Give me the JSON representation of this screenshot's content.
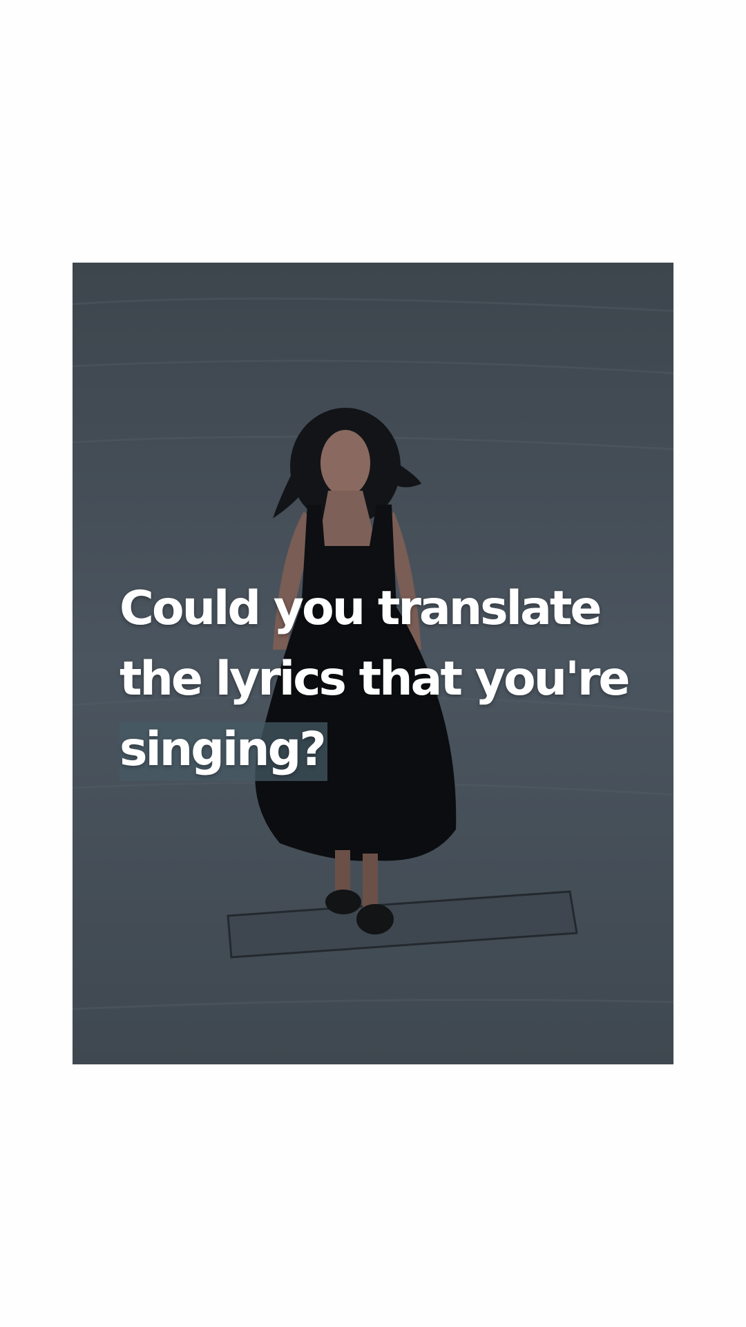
{
  "video": {
    "scene_description_icon": "person-walking-image",
    "colors": {
      "page_background": "#fefefe",
      "frame_tint": "#47505a",
      "caption_text": "#ffffff",
      "highlight_background": "#46595f"
    }
  },
  "caption": {
    "lines": [
      "Could you translate",
      "the lyrics that you're",
      "singing?"
    ],
    "highlighted_line_index": 2
  }
}
